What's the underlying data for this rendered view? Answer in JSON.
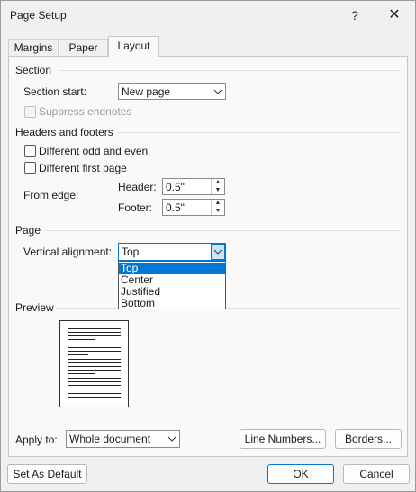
{
  "window": {
    "title": "Page Setup",
    "help_glyph": "?",
    "close_glyph": "✕"
  },
  "tabs": [
    {
      "label": "Margins",
      "active": false
    },
    {
      "label": "Paper",
      "active": false
    },
    {
      "label": "Layout",
      "active": true
    }
  ],
  "section": {
    "title": "Section",
    "start_label": "Section start:",
    "start_value": "New page",
    "suppress_endnotes_label": "Suppress endnotes"
  },
  "headers_footers": {
    "title": "Headers and footers",
    "odd_even_label": "Different odd and even",
    "first_page_label": "Different first page",
    "from_edge_label": "From edge:",
    "header_label": "Header:",
    "header_value": "0.5\"",
    "footer_label": "Footer:",
    "footer_value": "0.5\""
  },
  "page": {
    "title": "Page",
    "vertical_alignment_label": "Vertical alignment:",
    "vertical_alignment_value": "Top",
    "options": [
      "Top",
      "Center",
      "Justified",
      "Bottom"
    ],
    "selected_option": "Top"
  },
  "preview": {
    "title": "Preview"
  },
  "apply_to": {
    "label": "Apply to:",
    "value": "Whole document"
  },
  "buttons": {
    "line_numbers": "Line Numbers...",
    "borders": "Borders...",
    "set_default": "Set As Default",
    "ok": "OK",
    "cancel": "Cancel"
  },
  "icons": {
    "help": "help-icon",
    "close": "close-icon",
    "dropdown": "chevron-down-icon",
    "spin_up": "spin-up-icon",
    "spin_down": "spin-down-icon"
  },
  "colors": {
    "accent": "#0078d4",
    "window_bg": "#f0f0f0",
    "panel_bg": "#f9f9f9"
  }
}
